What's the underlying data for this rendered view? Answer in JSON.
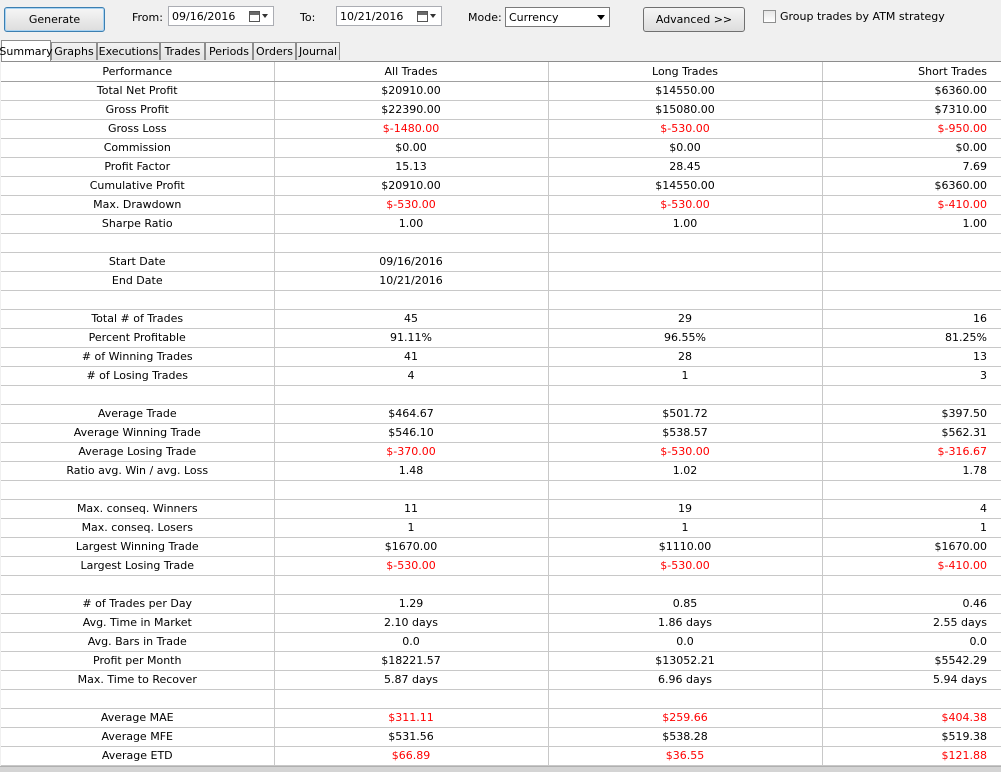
{
  "toolbar": {
    "generate_label": "Generate",
    "from_label": "From:",
    "from_value": "09/16/2016",
    "to_label": "To:",
    "to_value": "10/21/2016",
    "mode_label": "Mode:",
    "mode_value": "Currency",
    "advanced_label": "Advanced >>",
    "group_label": "Group trades by ATM strategy",
    "group_checked": false
  },
  "tabs": [
    "Summary",
    "Graphs",
    "Executions",
    "Trades",
    "Periods",
    "Orders",
    "Journal"
  ],
  "active_tab": "Summary",
  "table": {
    "headers": [
      "Performance",
      "All Trades",
      "Long Trades",
      "Short Trades"
    ],
    "rows": [
      [
        "Total Net Profit",
        "$20910.00",
        "$14550.00",
        "$6360.00"
      ],
      [
        "Gross Profit",
        "$22390.00",
        "$15080.00",
        "$7310.00"
      ],
      [
        "Gross Loss",
        "$-1480.00",
        "$-530.00",
        "$-950.00"
      ],
      [
        "Commission",
        "$0.00",
        "$0.00",
        "$0.00"
      ],
      [
        "Profit Factor",
        "15.13",
        "28.45",
        "7.69"
      ],
      [
        "Cumulative Profit",
        "$20910.00",
        "$14550.00",
        "$6360.00"
      ],
      [
        "Max. Drawdown",
        "$-530.00",
        "$-530.00",
        "$-410.00"
      ],
      [
        "Sharpe Ratio",
        "1.00",
        "1.00",
        "1.00"
      ],
      [
        "",
        "",
        "",
        ""
      ],
      [
        "Start Date",
        "09/16/2016",
        "",
        ""
      ],
      [
        "End Date",
        "10/21/2016",
        "",
        ""
      ],
      [
        "",
        "",
        "",
        ""
      ],
      [
        "Total # of Trades",
        "45",
        "29",
        "16"
      ],
      [
        "Percent Profitable",
        "91.11%",
        "96.55%",
        "81.25%"
      ],
      [
        "# of Winning Trades",
        "41",
        "28",
        "13"
      ],
      [
        "# of Losing Trades",
        "4",
        "1",
        "3"
      ],
      [
        "",
        "",
        "",
        ""
      ],
      [
        "Average Trade",
        "$464.67",
        "$501.72",
        "$397.50"
      ],
      [
        "Average Winning Trade",
        "$546.10",
        "$538.57",
        "$562.31"
      ],
      [
        "Average Losing Trade",
        "$-370.00",
        "$-530.00",
        "$-316.67"
      ],
      [
        "Ratio avg. Win / avg. Loss",
        "1.48",
        "1.02",
        "1.78"
      ],
      [
        "",
        "",
        "",
        ""
      ],
      [
        "Max. conseq. Winners",
        "11",
        "19",
        "4"
      ],
      [
        "Max. conseq. Losers",
        "1",
        "1",
        "1"
      ],
      [
        "Largest Winning Trade",
        "$1670.00",
        "$1110.00",
        "$1670.00"
      ],
      [
        "Largest Losing Trade",
        "$-530.00",
        "$-530.00",
        "$-410.00"
      ],
      [
        "",
        "",
        "",
        ""
      ],
      [
        "# of Trades per Day",
        "1.29",
        "0.85",
        "0.46"
      ],
      [
        "Avg. Time in Market",
        "2.10 days",
        "1.86 days",
        "2.55 days"
      ],
      [
        "Avg. Bars in Trade",
        "0.0",
        "0.0",
        "0.0"
      ],
      [
        "Profit per Month",
        "$18221.57",
        "$13052.21",
        "$5542.29"
      ],
      [
        "Max. Time to Recover",
        "5.87 days",
        "6.96 days",
        "5.94 days"
      ],
      [
        "",
        "",
        "",
        ""
      ],
      [
        "Average MAE",
        "$311.11",
        "$259.66",
        "$404.38"
      ],
      [
        "Average MFE",
        "$531.56",
        "$538.28",
        "$519.38"
      ],
      [
        "Average ETD",
        "$66.89",
        "$36.55",
        "$121.88"
      ]
    ],
    "red_rows": [
      "Gross Loss",
      "Max. Drawdown",
      "Average Losing Trade",
      "Largest Losing Trade",
      "Average MAE",
      "Average ETD"
    ]
  },
  "colors": {
    "negative": "#ff0000",
    "grid_line": "#c8c8c8",
    "background": "#f0f0f0"
  }
}
